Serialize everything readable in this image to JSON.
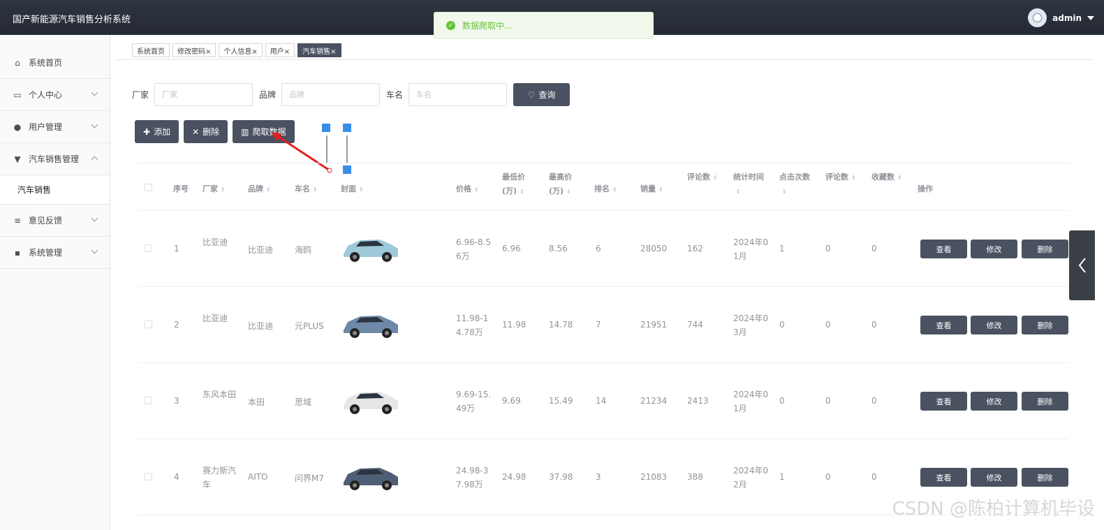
{
  "header": {
    "app_title": "国产新能源汽车销售分析系统",
    "user": "admin"
  },
  "toast": {
    "message": "数据爬取中..."
  },
  "sidebar": {
    "items": [
      {
        "label": "系统首页",
        "icon": "home-icon"
      },
      {
        "label": "个人中心",
        "icon": "window-icon"
      },
      {
        "label": "用户管理",
        "icon": "user-icon"
      },
      {
        "label": "汽车销售管理",
        "icon": "brush-icon",
        "sub": "汽车销售"
      },
      {
        "label": "意见反馈",
        "icon": "list-icon"
      },
      {
        "label": "系统管理",
        "icon": "chat-icon"
      }
    ]
  },
  "tabs": [
    "系统首页",
    "修改密码×",
    "个人信息×",
    "用户×",
    "汽车销售×"
  ],
  "search": {
    "maker_label": "厂家",
    "maker_placeholder": "厂家",
    "brand_label": "品牌",
    "brand_placeholder": "品牌",
    "name_label": "车名",
    "name_placeholder": "车名",
    "query_label": "查询"
  },
  "actions": {
    "add": "添加",
    "delete": "删除",
    "crawl": "爬取数据"
  },
  "table": {
    "headers": [
      "序号",
      "厂家",
      "品牌",
      "车名",
      "封面",
      "价格",
      "最低价(万)",
      "最高价(万)",
      "排名",
      "销量",
      "评论数",
      "统计时间",
      "点击次数",
      "评论数",
      "收藏数",
      "操作"
    ],
    "rows": [
      {
        "idx": "1",
        "maker": "比亚迪",
        "brand": "比亚迪",
        "name": "海鸥",
        "price": "6.96-8.56万",
        "low": "6.96",
        "high": "8.56",
        "rank": "6",
        "sales": "28050",
        "reviews": "162",
        "time": "2024年01月",
        "clicks": "1",
        "reviews2": "0",
        "favs": "0",
        "car_color": "#9fc8d8"
      },
      {
        "idx": "2",
        "maker": "比亚迪",
        "brand": "比亚迪",
        "name": "元PLUS",
        "price": "11.98-14.78万",
        "low": "11.98",
        "high": "14.78",
        "rank": "7",
        "sales": "21951",
        "reviews": "744",
        "time": "2024年03月",
        "clicks": "0",
        "reviews2": "0",
        "favs": "0",
        "car_color": "#6f8aa8"
      },
      {
        "idx": "3",
        "maker": "东风本田",
        "brand": "本田",
        "name": "思域",
        "price": "9.69-15.49万",
        "low": "9.69",
        "high": "15.49",
        "rank": "14",
        "sales": "21234",
        "reviews": "2413",
        "time": "2024年01月",
        "clicks": "0",
        "reviews2": "0",
        "favs": "0",
        "car_color": "#e6e6e6"
      },
      {
        "idx": "4",
        "maker": "赛力斯汽车",
        "brand": "AITO",
        "name": "问界M7",
        "price": "24.98-37.98万",
        "low": "24.98",
        "high": "37.98",
        "rank": "3",
        "sales": "21083",
        "reviews": "388",
        "time": "2024年02月",
        "clicks": "1",
        "reviews2": "0",
        "favs": "0",
        "car_color": "#4f5f75"
      }
    ],
    "row_actions": {
      "view": "查看",
      "edit": "修改",
      "delete": "删除"
    }
  },
  "watermark": "CSDN @陈柏计算机毕设"
}
